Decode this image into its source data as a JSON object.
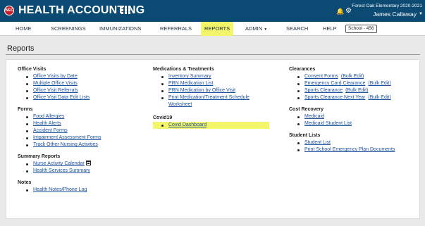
{
  "header": {
    "logo_text": "WEC",
    "title": "HEALTH ACCOUNTING",
    "school_year": "Forest Oak Elementary  2020-2021",
    "user": "James Callaway"
  },
  "nav": {
    "home": "HOME",
    "screenings": "SCREENINGS",
    "immunizations": "IMMUNIZATIONS",
    "referrals": "REFERRALS",
    "reports": "REPORTS",
    "admin": "ADMIN",
    "search": "SEARCH",
    "help": "HELP",
    "school_badge": "School - 456"
  },
  "page": {
    "title": "Reports"
  },
  "colors": {
    "header": "#0b4a72",
    "highlight": "#f3f56a",
    "link": "#1a4f9a"
  },
  "sections": {
    "office_visits": {
      "title": "Office Visits",
      "items": [
        "Office Visits by Date",
        "Multiple Office Visits",
        "Office Visit Referrals",
        "Office Visit Data Edit Lists"
      ]
    },
    "forms": {
      "title": "Forms",
      "items": [
        "Food Allergies",
        "Health Alerts",
        "Accident Forms",
        "Impairment Assessment Forms",
        "Track Other Nursing Activities"
      ]
    },
    "summary_reports": {
      "title": "Summary Reports",
      "items": [
        "Nurse Activity Calendar",
        "Health Services Summary"
      ]
    },
    "notes": {
      "title": "Notes",
      "items": [
        "Health Notes/Phone Log"
      ]
    },
    "medications": {
      "title": "Medications & Treatments",
      "items": [
        "Inventory Summary",
        "PRN Medication List",
        "PRN Medication by Office Visit",
        "Print Medication/Treatment Schedule Worksheet"
      ]
    },
    "covid19": {
      "title": "Covid19",
      "items": [
        "Covid Dashboard"
      ]
    },
    "clearances": {
      "title": "Clearances",
      "items": [
        "Consent Forms",
        "Emergency Card Clearance",
        "Sports Clearance",
        "Sports Clearance Next Year"
      ],
      "bulk_edit": "(Bulk Edit)"
    },
    "cost_recovery": {
      "title": "Cost Recovery",
      "items": [
        "Medicaid",
        "Medicaid Student List"
      ]
    },
    "student_lists": {
      "title": "Student Lists",
      "items": [
        "Student List",
        "Print School Emergency Plan Documents"
      ]
    }
  }
}
